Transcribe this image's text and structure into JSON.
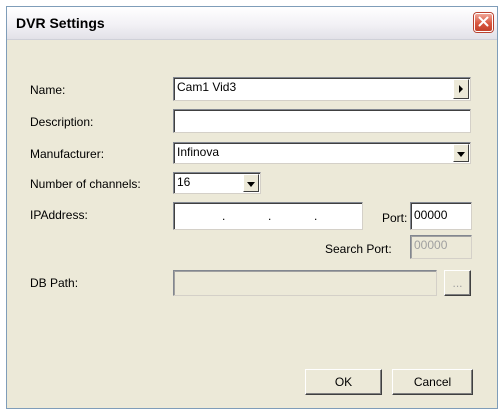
{
  "dialog": {
    "title": "DVR Settings"
  },
  "form": {
    "name_label": "Name:",
    "name_value": "Cam1 Vid3",
    "description_label": "Description:",
    "description_value": "",
    "manufacturer_label": "Manufacturer:",
    "manufacturer_value": "Infinova",
    "channels_label": "Number of channels:",
    "channels_value": "16",
    "ip_label": "IPAddress:",
    "ip_dots": [
      ".",
      ".",
      "."
    ],
    "port_label": "Port:",
    "port_value": "00000",
    "search_port_label": "Search Port:",
    "search_port_value": "00000",
    "db_path_label": "DB Path:",
    "db_path_value": "",
    "browse_label": "..."
  },
  "buttons": {
    "ok": "OK",
    "cancel": "Cancel"
  },
  "icons": {
    "close": "close-icon",
    "name_arrow": "arrow-right-icon",
    "dropdown": "chevron-down-icon"
  },
  "colors": {
    "dialog_bg": "#ece9d8",
    "close_red": "#d8573f"
  }
}
